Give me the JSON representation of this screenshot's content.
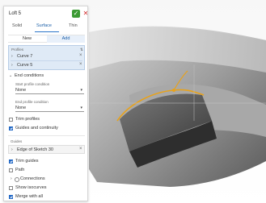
{
  "panel": {
    "title": "Loft 5",
    "ok_icon": "check-icon",
    "cancel_icon": "close-icon",
    "tabs": [
      {
        "label": "Solid"
      },
      {
        "label": "Surface"
      },
      {
        "label": "Thin"
      }
    ],
    "segments": [
      {
        "label": "New"
      },
      {
        "label": "Add"
      }
    ],
    "profiles": {
      "label": "Profiles",
      "items": [
        {
          "label": "Curve 7"
        },
        {
          "label": "Curve 5"
        }
      ]
    },
    "end_conditions": {
      "label": "End conditions",
      "start_label": "Start profile condition",
      "start_value": "None",
      "end_label": "End profile condition",
      "end_value": "None"
    },
    "trim_profiles": {
      "label": "Trim profiles",
      "checked": false
    },
    "guides_continuity": {
      "label": "Guides and continuity",
      "checked": true
    },
    "guides": {
      "label": "Guides",
      "items": [
        {
          "label": "Edge of Sketch 30"
        }
      ]
    },
    "trim_guides": {
      "label": "Trim guides",
      "checked": true
    },
    "path": {
      "label": "Path",
      "checked": false
    },
    "connections": {
      "label": "Connections"
    },
    "show_isocurves": {
      "label": "Show isocurves",
      "checked": false
    },
    "merge_with_all": {
      "label": "Merge with all",
      "checked": true
    }
  },
  "colors": {
    "accent": "#2b74c9",
    "ok": "#3c9a34",
    "cancel": "#d12b2b",
    "selection": "#dfeaf6",
    "loft_edge": "#e8a21a"
  }
}
